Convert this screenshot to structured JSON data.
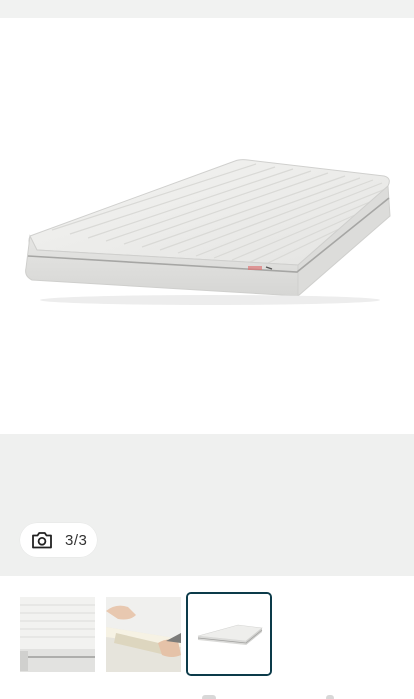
{
  "gallery": {
    "counter_text": "3/3",
    "camera_icon": "camera-icon"
  },
  "colors": {
    "selected_thumb_border": "#0c3b4a",
    "gray_background": "#eff0ef"
  }
}
